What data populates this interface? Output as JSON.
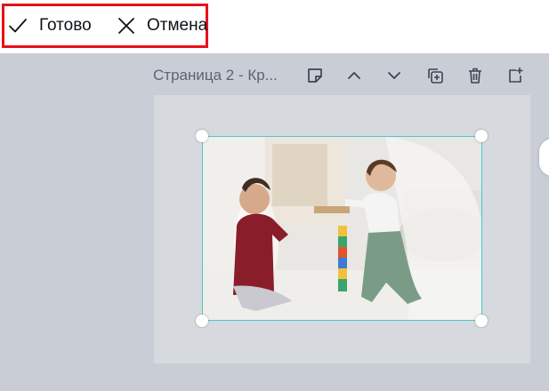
{
  "actions": {
    "done": {
      "label": "Готово",
      "icon": "check-icon"
    },
    "cancel": {
      "label": "Отмена",
      "icon": "close-icon"
    }
  },
  "page_toolbar": {
    "title": "Страница 2 - Кр...",
    "buttons": [
      {
        "name": "add-note-button",
        "icon": "sticky-note-icon"
      },
      {
        "name": "move-page-up-button",
        "icon": "chevron-up-icon"
      },
      {
        "name": "move-page-down-button",
        "icon": "chevron-down-icon"
      },
      {
        "name": "duplicate-page-button",
        "icon": "duplicate-icon"
      },
      {
        "name": "delete-page-button",
        "icon": "trash-icon"
      },
      {
        "name": "add-page-button",
        "icon": "add-page-icon"
      }
    ]
  },
  "colors": {
    "highlight_border": "#e8111a",
    "selection": "#47c7d0",
    "canvas_bg": "#c9ced6",
    "page_bg": "#d6dade"
  }
}
